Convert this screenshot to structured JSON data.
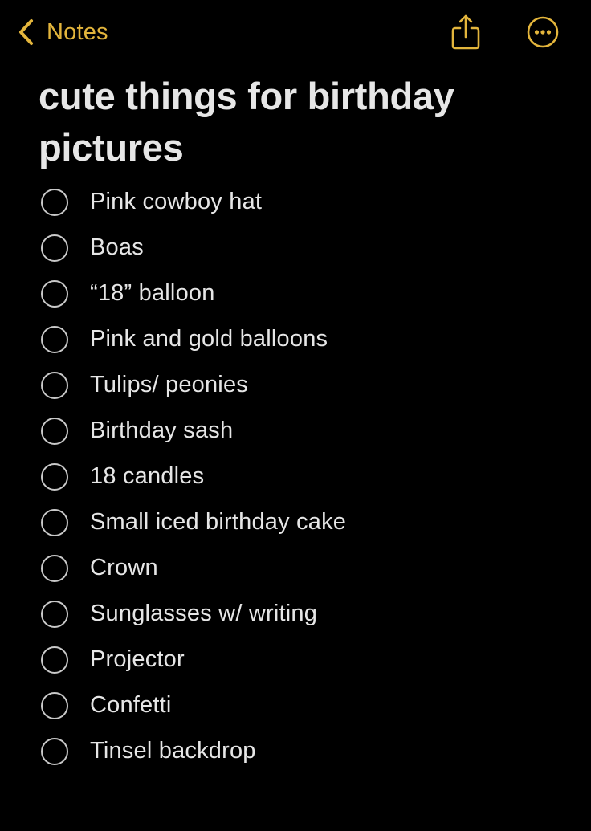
{
  "nav": {
    "back_label": "Notes",
    "accent_color": "#e3b53c",
    "share_icon": "share-icon",
    "more_icon": "more-ellipsis-icon"
  },
  "note": {
    "title": "cute things for birthday pictures",
    "checklist": [
      {
        "label": "Pink cowboy hat",
        "checked": false
      },
      {
        "label": "Boas",
        "checked": false
      },
      {
        "label": "“18” balloon",
        "checked": false
      },
      {
        "label": "Pink and gold balloons",
        "checked": false
      },
      {
        "label": "Tulips/ peonies",
        "checked": false
      },
      {
        "label": "Birthday sash",
        "checked": false
      },
      {
        "label": "18 candles",
        "checked": false
      },
      {
        "label": "Small iced birthday cake",
        "checked": false
      },
      {
        "label": "Crown",
        "checked": false
      },
      {
        "label": "Sunglasses w/ writing",
        "checked": false
      },
      {
        "label": "Projector",
        "checked": false
      },
      {
        "label": "Confetti",
        "checked": false
      },
      {
        "label": "Tinsel backdrop",
        "checked": false
      }
    ]
  }
}
